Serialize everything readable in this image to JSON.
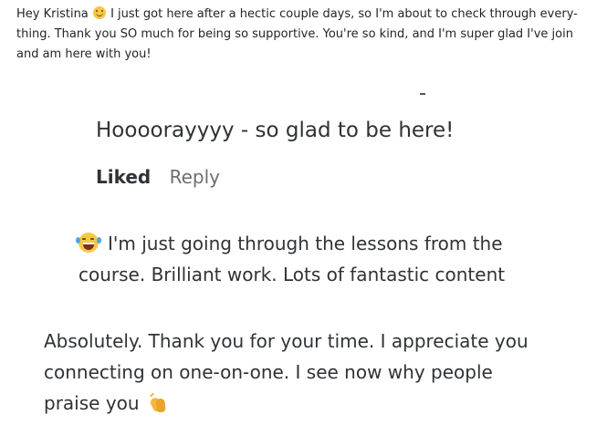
{
  "messages": {
    "first": {
      "line1": "Hey Kristina",
      "line1_rest": "I just got here after a hectic couple days, so I'm about to check through every-",
      "line2": "thing. Thank you SO much for being so supportive. You're so kind, and I'm super glad I've join",
      "line3": "and am here with you!",
      "emoji": "smile-emoji-icon"
    },
    "second": {
      "text": "Hoooorayyyy - so glad to be here!"
    },
    "actions": {
      "liked_label": "Liked",
      "reply_label": "Reply"
    },
    "third": {
      "line1": "I'm just going through the lessons from the",
      "line2": "course. Brilliant work. Lots of fantastic content",
      "emoji": "laughing-tears-emoji-icon"
    },
    "fourth": {
      "line1": "Absolutely. Thank you for your time. I appreciate you",
      "line2": "connecting on one-on-one. I see now why people",
      "line3": "praise you",
      "emoji": "clapping-hands-emoji-icon"
    }
  }
}
